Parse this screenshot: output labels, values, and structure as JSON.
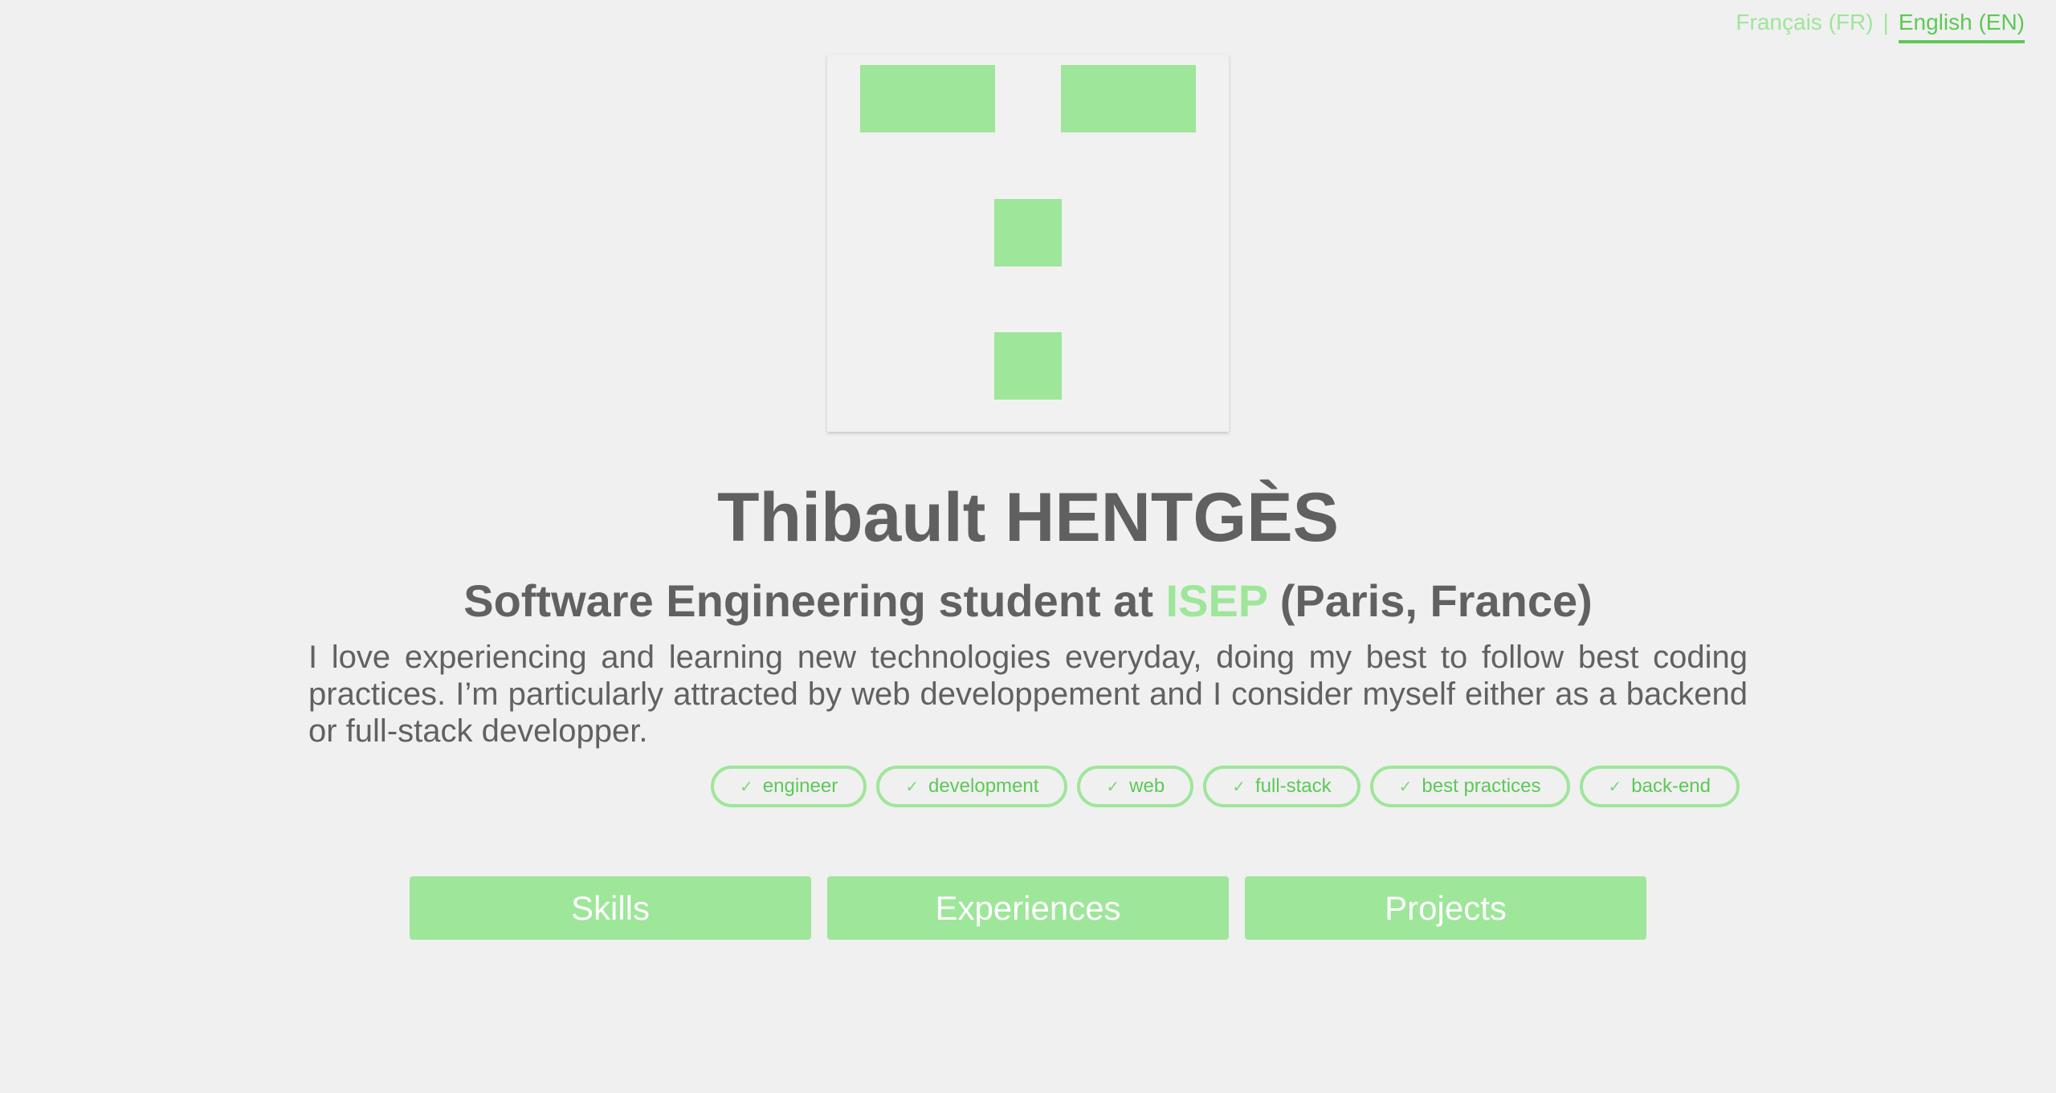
{
  "language_switcher": {
    "french": "Français (FR)",
    "separator": "|",
    "english": "English (EN)",
    "active": "english"
  },
  "logo": {
    "icon": "logo-blocks-icon",
    "color": "#9ee69a"
  },
  "profile": {
    "name": "Thibault HENTGÈS",
    "subtitle_prefix": "Software Engineering student at ",
    "school": "ISEP",
    "subtitle_suffix": " (Paris, France)",
    "bio": "I love experiencing and learning new technologies everyday, doing my best to follow best coding practices. I’m particularly attracted by web developpement and I consider myself either as a backend or full-stack developper."
  },
  "tags": [
    {
      "label": "engineer",
      "icon": "check-icon"
    },
    {
      "label": "development",
      "icon": "check-icon"
    },
    {
      "label": "web",
      "icon": "check-icon"
    },
    {
      "label": "full-stack",
      "icon": "check-icon"
    },
    {
      "label": "best practices",
      "icon": "check-icon"
    },
    {
      "label": "back-end",
      "icon": "check-icon"
    }
  ],
  "nav": {
    "skills": "Skills",
    "experiences": "Experiences",
    "projects": "Projects"
  },
  "colors": {
    "accent": "#9ee69a",
    "accent_dark": "#5cc956",
    "text": "#616161",
    "background": "#f0f0f0"
  }
}
